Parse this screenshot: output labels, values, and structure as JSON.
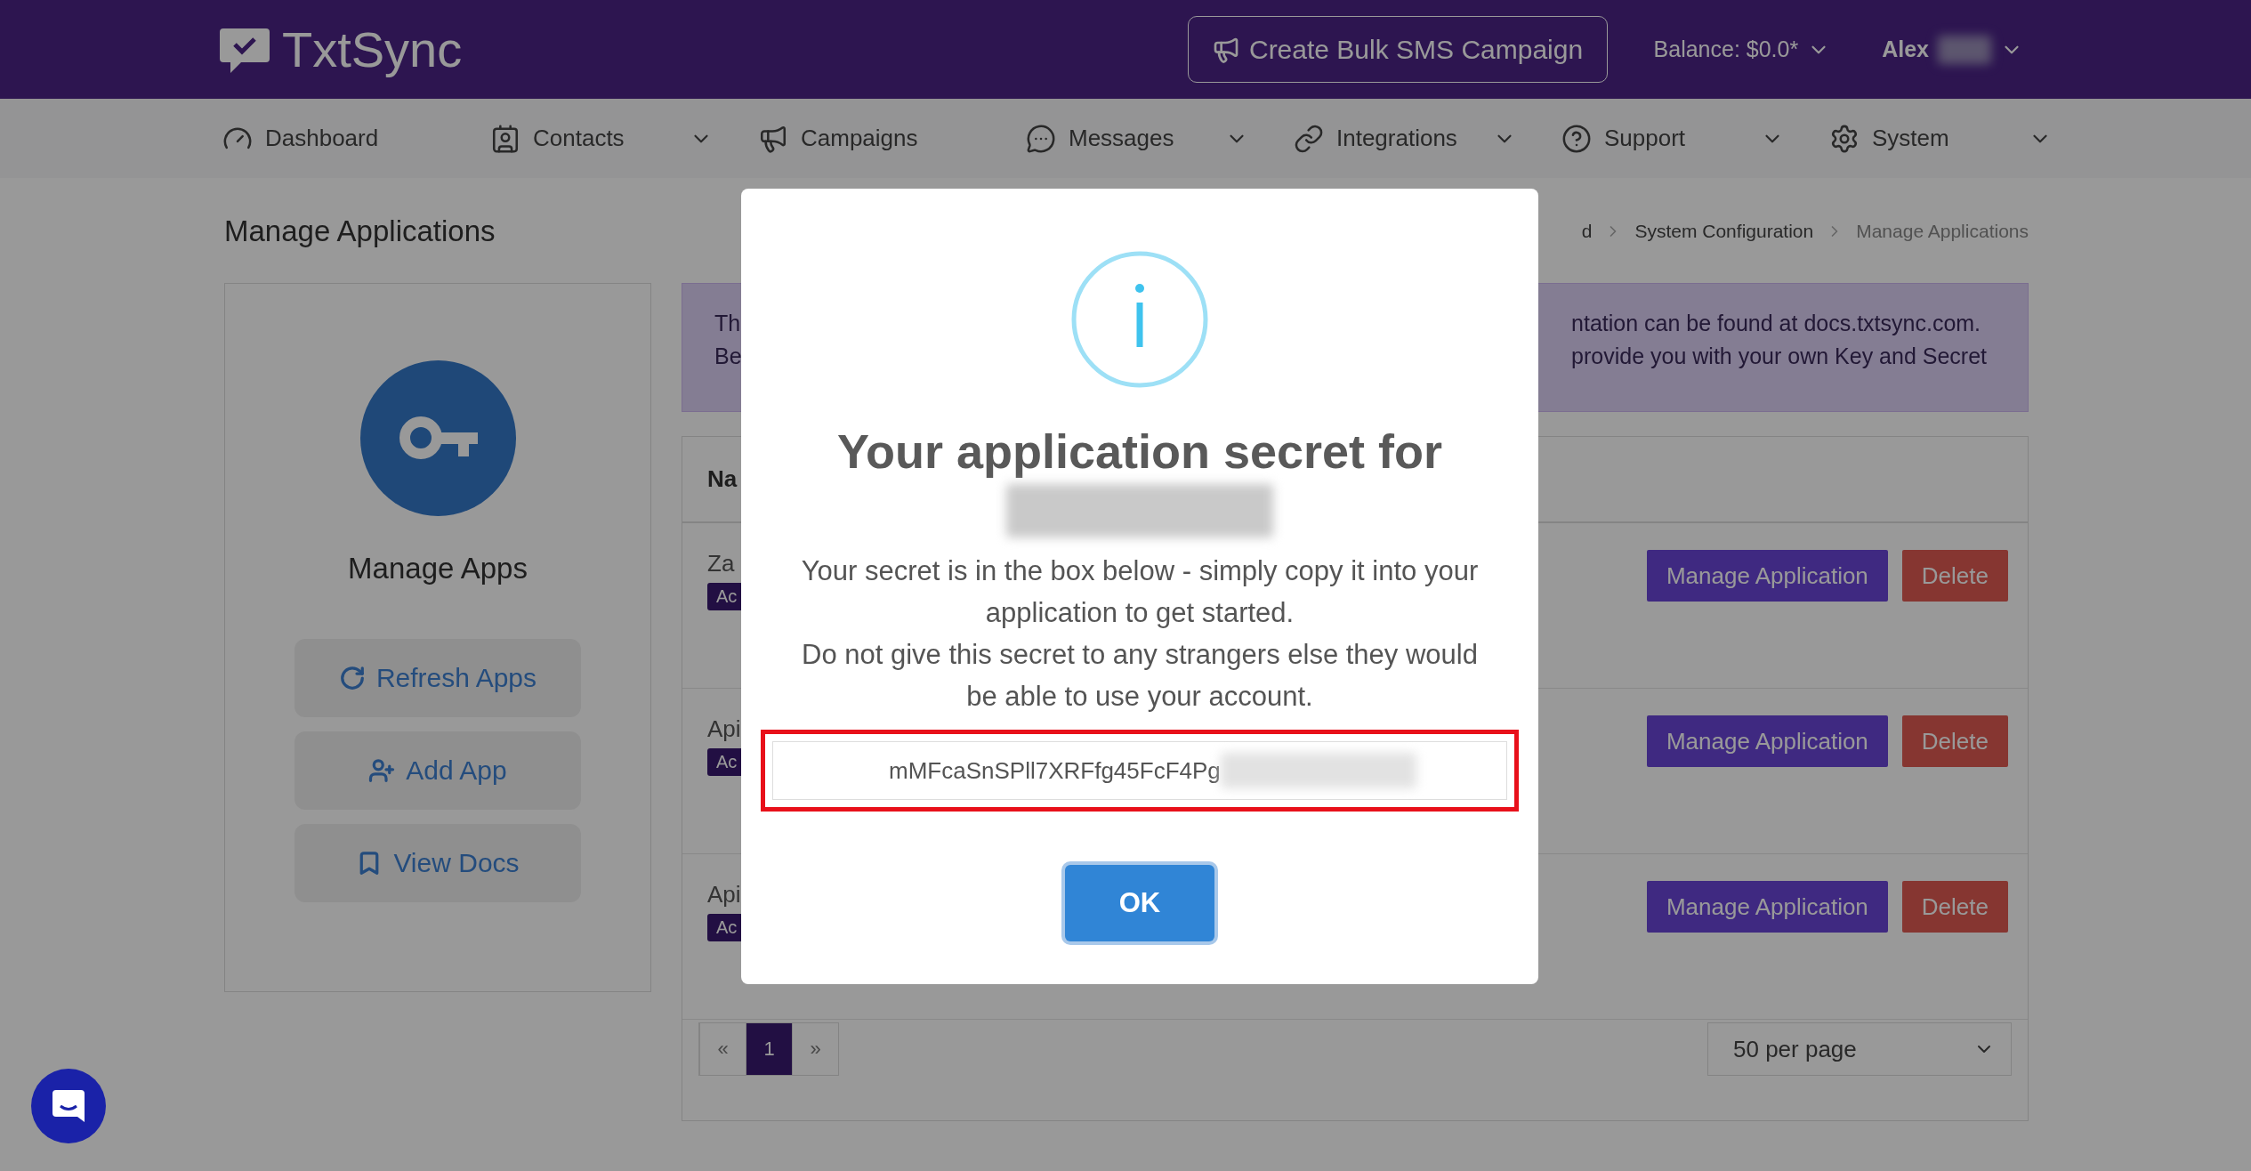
{
  "header": {
    "logo": "TxtSync",
    "campaign_button": "Create Bulk SMS Campaign",
    "balance": "Balance: $0.0*",
    "user": "Alex"
  },
  "nav": [
    {
      "label": "Dashboard",
      "kind": "gauge",
      "dropdown": false
    },
    {
      "label": "Contacts",
      "kind": "contacts",
      "dropdown": true
    },
    {
      "label": "Campaigns",
      "kind": "megaphone",
      "dropdown": false
    },
    {
      "label": "Messages",
      "kind": "sms",
      "dropdown": true
    },
    {
      "label": "Integrations",
      "kind": "link",
      "dropdown": true
    },
    {
      "label": "Support",
      "kind": "help",
      "dropdown": true
    },
    {
      "label": "System",
      "kind": "gear",
      "dropdown": true
    }
  ],
  "page_title": "Manage Applications",
  "breadcrumb": [
    "d",
    "System Configuration",
    "Manage Applications"
  ],
  "sidebar": {
    "title": "Manage Apps",
    "buttons": [
      {
        "label": "Refresh Apps",
        "kind": "refresh"
      },
      {
        "label": "Add App",
        "kind": "add"
      },
      {
        "label": "View Docs",
        "kind": "docs"
      }
    ]
  },
  "alert": {
    "left_lines": [
      "Th",
      "Be"
    ],
    "right_lines": [
      "ntation can be found at docs.txtsync.com.",
      "provide you with your own Key and Secret"
    ]
  },
  "table": {
    "header": "Na",
    "rows": [
      {
        "name": "Za",
        "badge": "Ac",
        "actions": [
          "Manage Application",
          "Delete"
        ]
      },
      {
        "name": "Api",
        "badge": "Ac",
        "actions": [
          "Manage Application",
          "Delete"
        ]
      },
      {
        "name": "Api",
        "badge": "Ac",
        "actions": [
          "Manage Application",
          "Delete"
        ]
      }
    ]
  },
  "pagination": {
    "pages": [
      {
        "label": "«",
        "selected": false
      },
      {
        "label": "1",
        "selected": true
      },
      {
        "label": "»",
        "selected": false
      }
    ],
    "per_page": "50 per page"
  },
  "modal": {
    "title": "Your application secret for",
    "messages": [
      "Your secret is in the box below - simply copy it into your application to get started.",
      "Do not give this secret to any strangers else they would be able to use your account."
    ],
    "secret": "mMFcaSnSPll7XRFfg45FcF4Pg",
    "button": "OK"
  }
}
